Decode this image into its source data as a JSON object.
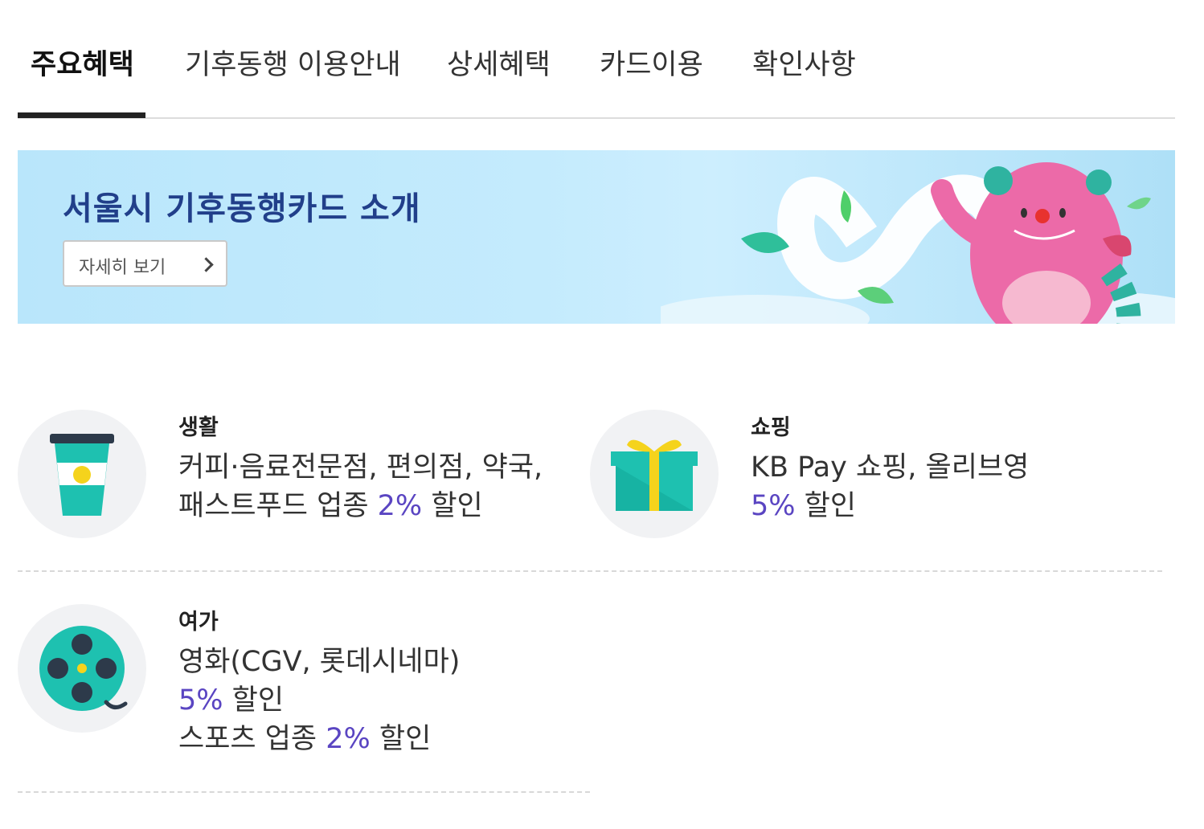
{
  "tabs": [
    {
      "label": "주요혜택",
      "active": true
    },
    {
      "label": "기후동행 이용안내",
      "active": false
    },
    {
      "label": "상세혜택",
      "active": false
    },
    {
      "label": "카드이용",
      "active": false
    },
    {
      "label": "확인사항",
      "active": false
    }
  ],
  "banner": {
    "title": "서울시 기후동행카드 소개",
    "button_label": "자세히 보기"
  },
  "benefits": {
    "life": {
      "category": "생활",
      "line1": "커피·음료전문점, 편의점, 약국,",
      "line2_prefix": "패스트푸드 업종 ",
      "line2_pct": "2%",
      "line2_suffix": " 할인"
    },
    "shopping": {
      "category": "쇼핑",
      "line1": "KB Pay 쇼핑, 올리브영",
      "line2_pct": "5%",
      "line2_suffix": " 할인"
    },
    "leisure": {
      "category": "여가",
      "line1": "영화(CGV, 롯데시네마)",
      "line2_pct": "5%",
      "line2_suffix": " 할인",
      "line3_prefix": "스포츠 업종 ",
      "line3_pct": "2%",
      "line3_suffix": " 할인"
    }
  },
  "colors": {
    "accent": "#5a45c2",
    "banner_title": "#213f8a",
    "icon_teal": "#1ec1b0",
    "icon_yellow": "#f5d31c",
    "icon_dark": "#2d3a4a"
  },
  "icons": {
    "life": "coffee-cup-icon",
    "shopping": "gift-box-icon",
    "leisure": "film-reel-icon"
  }
}
